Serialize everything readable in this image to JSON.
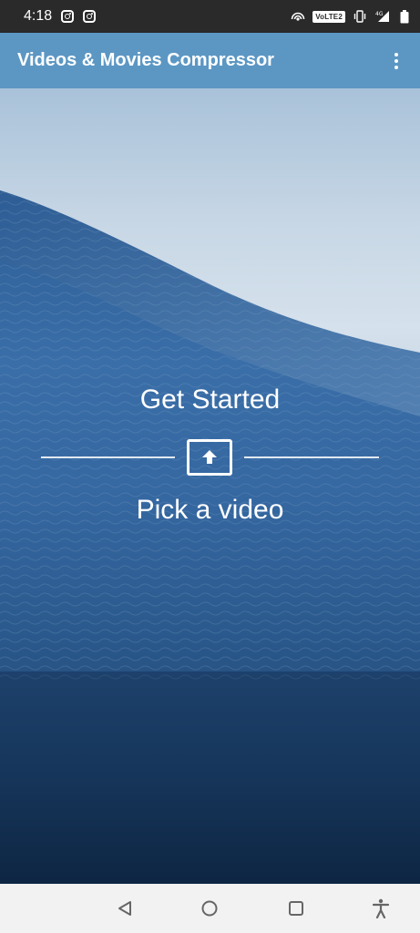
{
  "status_bar": {
    "time": "4:18",
    "network_badge": "VoLTE2",
    "icons": [
      "instagram-icon",
      "instagram-icon",
      "hotspot-icon",
      "vibrate-icon",
      "signal-4g-icon",
      "battery-icon"
    ]
  },
  "app_bar": {
    "title": "Videos & Movies Compressor",
    "menu_icon": "more-vert-icon",
    "color": "#5c97c4"
  },
  "main": {
    "heading": "Get Started",
    "pick_icon": "upload-icon",
    "pick_label": "Pick a video",
    "background": "ocean-wave-image"
  },
  "nav_bar": {
    "buttons": [
      "back-icon",
      "home-icon",
      "recents-icon",
      "accessibility-icon"
    ]
  }
}
